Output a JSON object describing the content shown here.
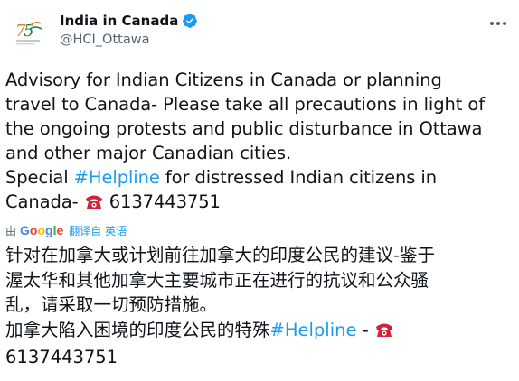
{
  "account": {
    "display_name": "India in Canada",
    "handle": "@HCI_Ottawa",
    "verified": true
  },
  "tweet": {
    "line1": "Advisory for Indian Citizens in Canada or planning",
    "line2": "travel to Canada- Please take all precautions in light of",
    "line3": "the ongoing protests and public disturbance in Ottawa",
    "line4": "and other major Canadian cities.",
    "line5_pre": "Special ",
    "line5_hashtag": "#Helpline",
    "line5_post": " for distressed Indian citizens in",
    "line6_pre": "Canada- ",
    "line6_post": " 6137443751"
  },
  "translation": {
    "by_label": "由",
    "provider": [
      "G",
      "o",
      "o",
      "g",
      "l",
      "e"
    ],
    "provider_colors": [
      "#4285f4",
      "#ea4335",
      "#fbbc05",
      "#4285f4",
      "#34a853",
      "#ea4335"
    ],
    "link_label": "翻译自 英语",
    "line1": "针对在加拿大或计划前往加拿大的印度公民的建议-鉴于",
    "line2": "渥太华和其他加拿大主要城市正在进行的抗议和公众骚",
    "line3": "乱，请采取一切预防措施。",
    "line4_pre": "加拿大陷入困境的印度公民的特殊",
    "line4_hashtag": "#Helpline",
    "line4_post": " - ",
    "line5": "6137443751"
  },
  "colors": {
    "accent": "#1d9bf0",
    "text": "#0f1419",
    "secondary": "#536471",
    "phone_emoji": "#d1243a"
  },
  "icons": [
    "logo-avatar",
    "verified-badge-icon",
    "more-options-icon",
    "telephone-icon"
  ]
}
